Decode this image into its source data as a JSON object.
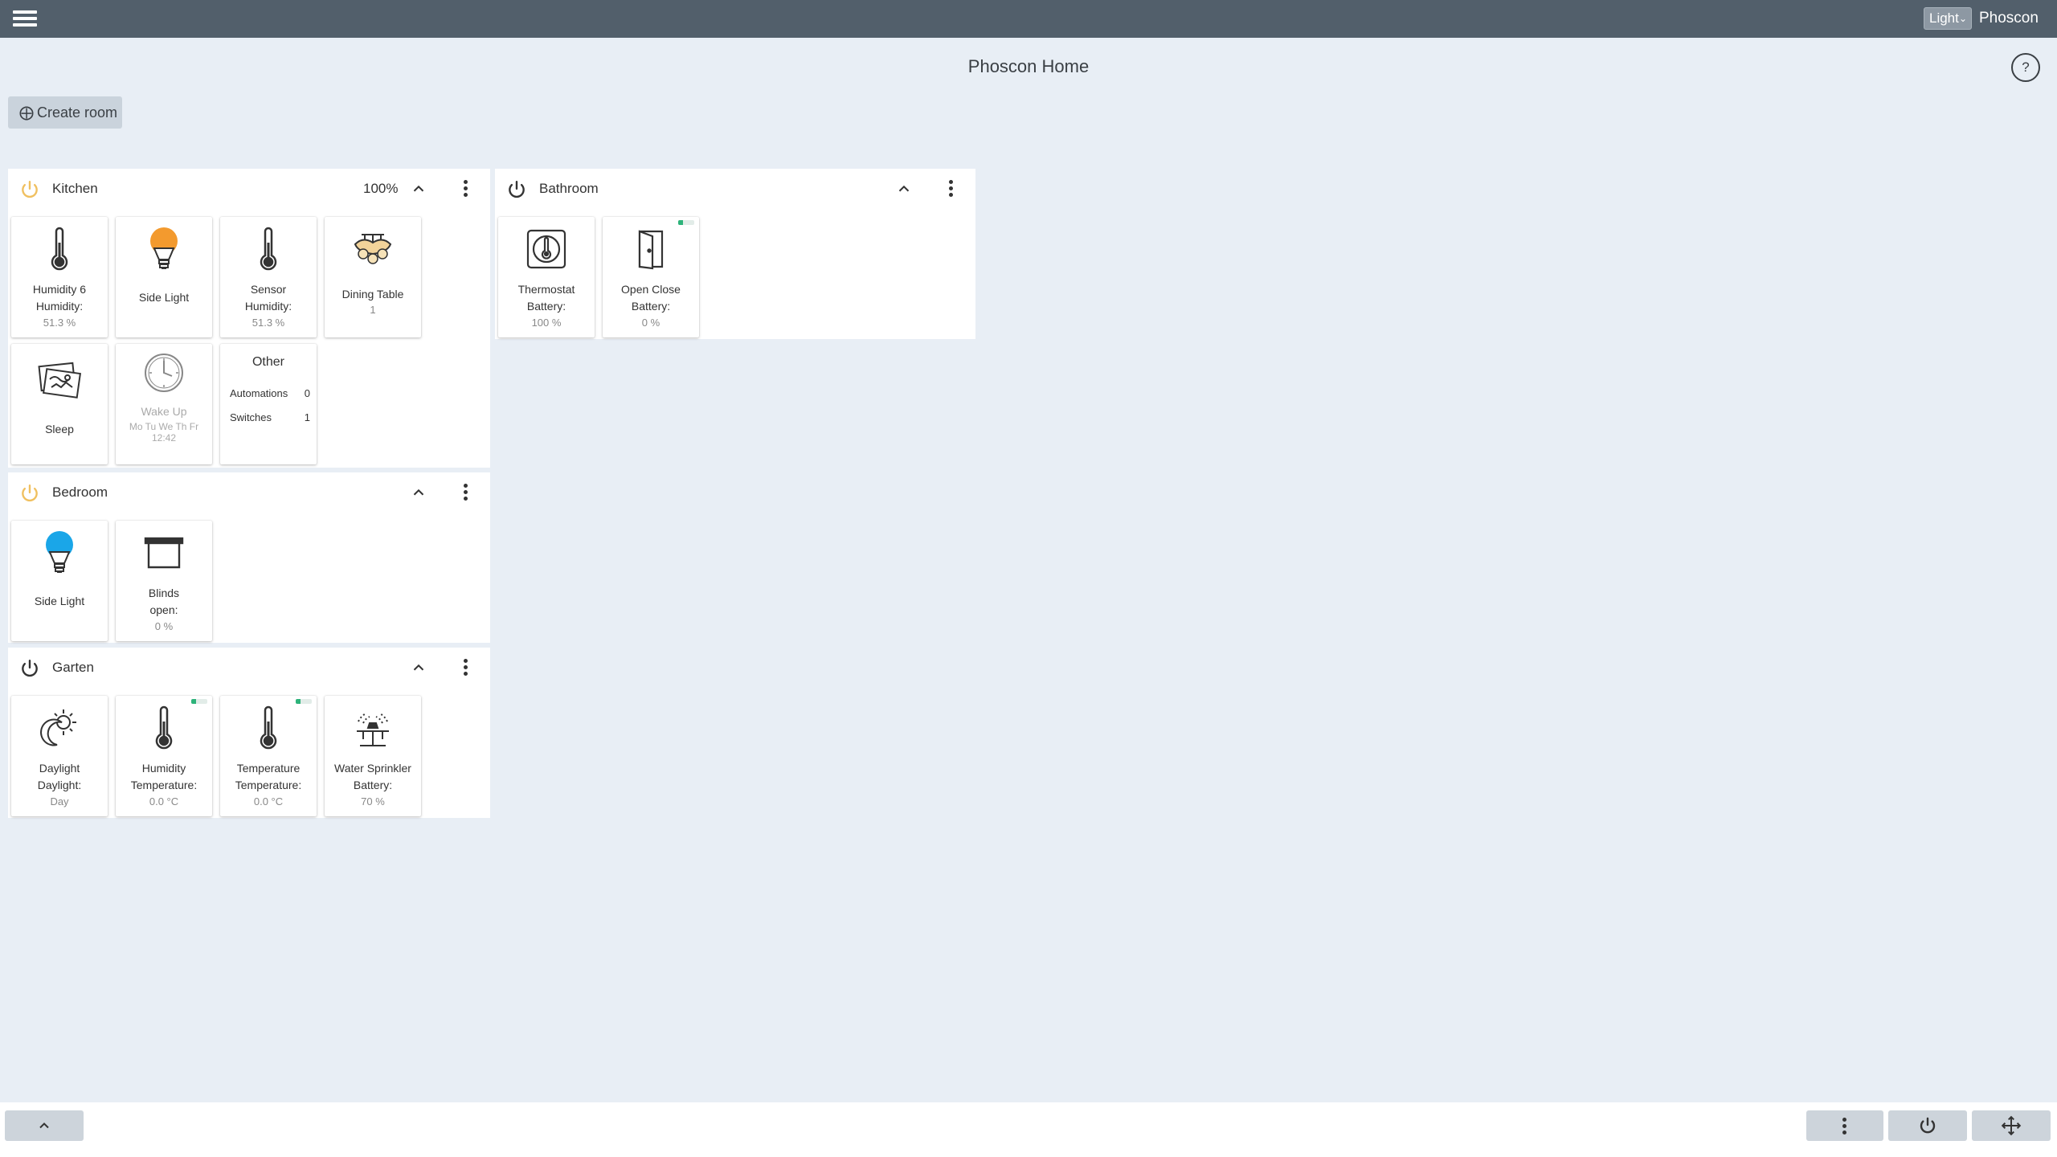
{
  "topbar": {
    "theme_value": "Light",
    "brand": "Phoscon"
  },
  "page": {
    "title": "Phoscon Home",
    "help_label": "?",
    "create_room_label": "Create room"
  },
  "rooms": {
    "kitchen": {
      "name": "Kitchen",
      "brightness": "100%",
      "tiles": {
        "humidity6": {
          "label": "Humidity 6",
          "sublabel": "Humidity:",
          "value": "51.3 %"
        },
        "sidelight": {
          "label": "Side Light"
        },
        "sensor": {
          "label": "Sensor",
          "sublabel": "Humidity:",
          "value": "51.3 %"
        },
        "dining": {
          "label": "Dining Table",
          "value": "1"
        },
        "sleep": {
          "label": "Sleep"
        },
        "wakeup": {
          "label": "Wake Up",
          "value": "Mo Tu We Th Fr 12:42"
        },
        "other": {
          "title": "Other",
          "automations_label": "Automations",
          "automations_count": "0",
          "switches_label": "Switches",
          "switches_count": "1"
        }
      }
    },
    "bathroom": {
      "name": "Bathroom",
      "tiles": {
        "thermostat": {
          "label": "Thermostat",
          "sublabel": "Battery:",
          "value": "100 %"
        },
        "openclose": {
          "label": "Open Close",
          "sublabel": "Battery:",
          "value": "0 %"
        }
      }
    },
    "bedroom": {
      "name": "Bedroom",
      "tiles": {
        "sidelight": {
          "label": "Side Light"
        },
        "blinds": {
          "label": "Blinds",
          "sublabel": "open:",
          "value": "0 %"
        }
      }
    },
    "garten": {
      "name": "Garten",
      "tiles": {
        "daylight": {
          "label": "Daylight",
          "sublabel": "Daylight:",
          "value": "Day"
        },
        "humidity": {
          "label": "Humidity",
          "sublabel": "Temperature:",
          "value": "0.0 °C"
        },
        "temperature": {
          "label": "Temperature",
          "sublabel": "Temperature:",
          "value": "0.0 °C"
        },
        "sprinkler": {
          "label": "Water Sprinkler",
          "sublabel": "Battery:",
          "value": "70 %"
        }
      }
    }
  },
  "colors": {
    "topbar": "#525f6b",
    "background": "#e8eef5",
    "power_on": "#f0c060",
    "bulb_orange": "#f39a2e",
    "bulb_blue": "#1aa6e8",
    "battery_green": "#2db37a"
  },
  "icons": {
    "menu": "hamburger-icon",
    "help": "help-icon",
    "add": "plus-icon",
    "power": "power-icon",
    "collapse": "chevron-up-icon",
    "more": "more-vertical-icon",
    "thermometer": "thermometer-icon",
    "bulb": "light-bulb-icon",
    "ceiling_lamp": "ceiling-lamp-icon",
    "sleep": "sleep-scene-icon",
    "clock": "clock-icon",
    "thermostat": "thermostat-icon",
    "door": "door-icon",
    "blinds": "blinds-icon",
    "daylight": "sun-moon-icon",
    "sprinkler": "sprinkler-icon",
    "move": "move-arrows-icon"
  }
}
